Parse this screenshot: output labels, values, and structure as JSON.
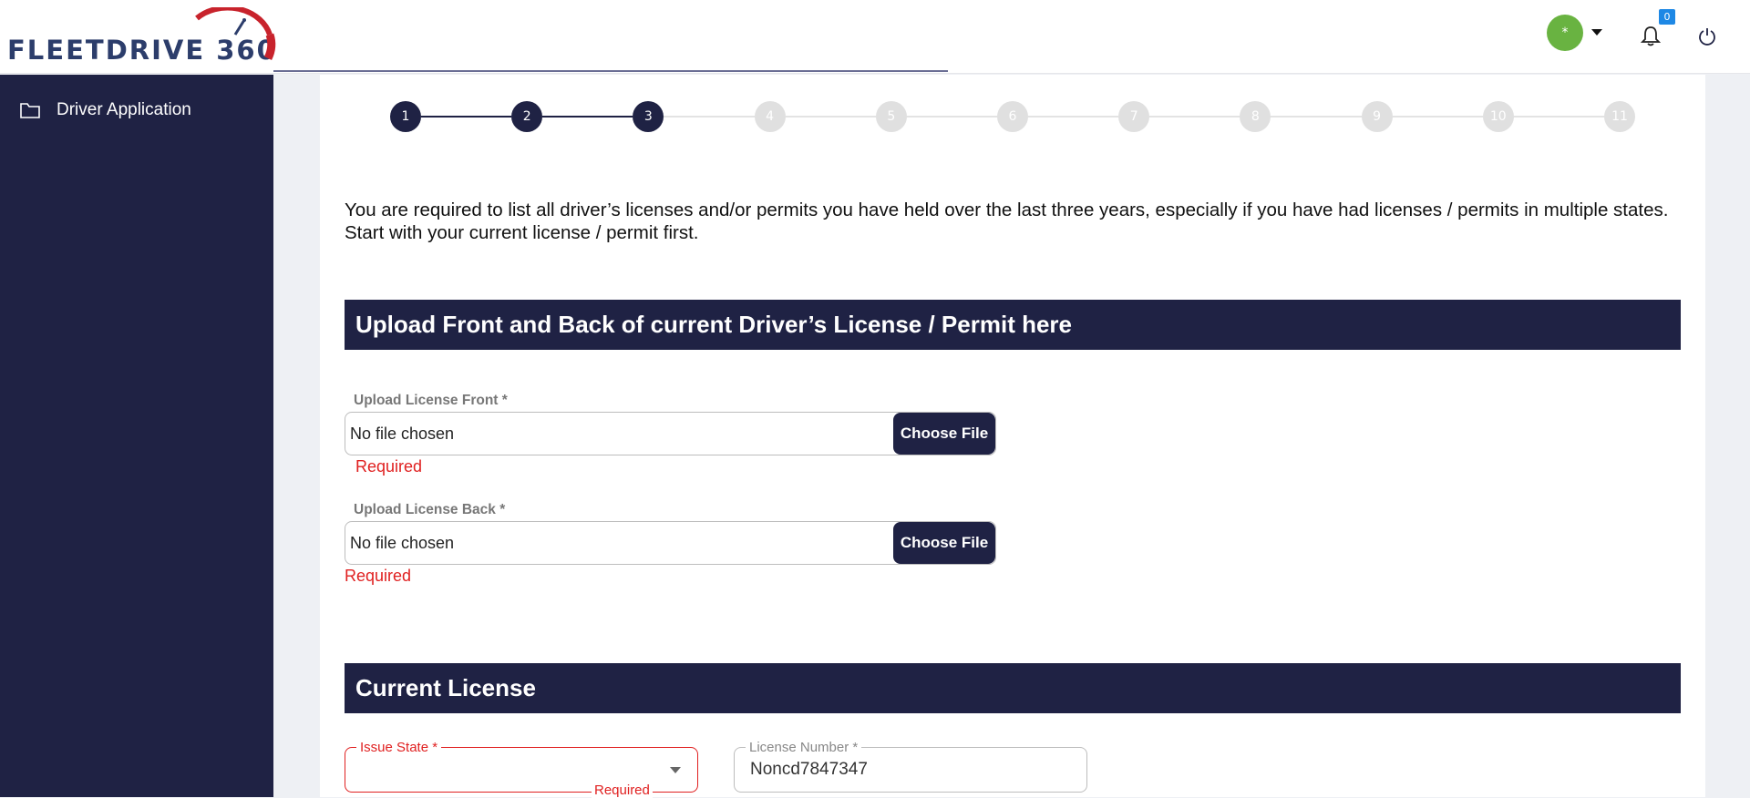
{
  "header": {
    "logo_text": "FLEETDRIVE 360",
    "avatar_initial": "*",
    "notification_count": "0"
  },
  "sidebar": {
    "items": [
      {
        "label": "Driver Application",
        "icon": "folder-icon"
      }
    ]
  },
  "stepper": {
    "steps": [
      "1",
      "2",
      "3",
      "4",
      "5",
      "6",
      "7",
      "8",
      "9",
      "10",
      "11"
    ],
    "current_step": 3
  },
  "intro_text": "You are required to list all driver’s licenses and/or permits you have held over the last three years, especially if you have had licenses / permits in multiple states. Start with your current license / permit first.",
  "upload_section": {
    "title": "Upload Front and Back of current Driver’s License / Permit here",
    "front": {
      "label": "Upload License Front *",
      "value": "No file chosen",
      "button": "Choose File",
      "error": "Required"
    },
    "back": {
      "label": "Upload License Back *",
      "value": "No file chosen",
      "button": "Choose File",
      "error": "Required"
    }
  },
  "current_license": {
    "title": "Current License",
    "issue_state": {
      "label": "Issue State *",
      "value": "",
      "error": "Required"
    },
    "license_number": {
      "label": "License Number *",
      "value": "Noncd7847347"
    }
  },
  "colors": {
    "navy": "#1f2244",
    "error": "#e02020",
    "avatar": "#69b341",
    "badge": "#1e88e5",
    "logo_red": "#c8232c",
    "logo_blue": "#2c3d6b"
  }
}
